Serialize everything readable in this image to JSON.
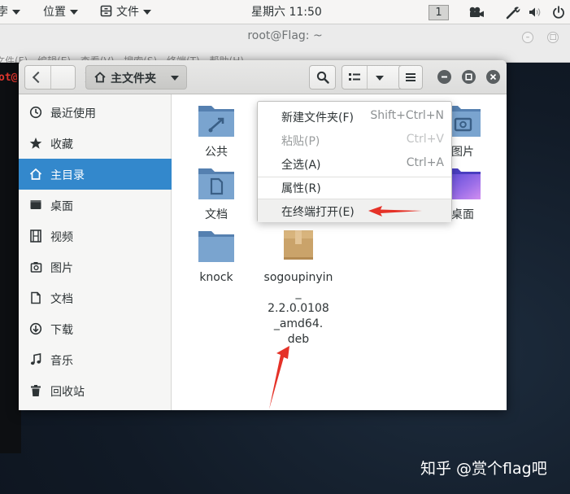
{
  "topbar": {
    "partial_left": "孛",
    "places_label": "位置",
    "files_label": "文件",
    "clock": "星期六 11:50",
    "workspace": "1"
  },
  "terminal": {
    "title": "root@Flag: ~",
    "menu": "文件(F)  编辑(E)  查看(V)  搜索(S)  终端(T)  帮助(H)",
    "prompt": "ot@"
  },
  "file_manager": {
    "path_label": "主文件夹",
    "sidebar": [
      {
        "label": "最近使用",
        "icon": "clock-icon"
      },
      {
        "label": "收藏",
        "icon": "star-icon"
      },
      {
        "label": "主目录",
        "icon": "home-icon",
        "active": true
      },
      {
        "label": "桌面",
        "icon": "desktop-icon"
      },
      {
        "label": "视频",
        "icon": "film-icon"
      },
      {
        "label": "图片",
        "icon": "picture-icon"
      },
      {
        "label": "文档",
        "icon": "document-icon"
      },
      {
        "label": "下载",
        "icon": "download-icon"
      },
      {
        "label": "音乐",
        "icon": "music-icon"
      },
      {
        "label": "回收站",
        "icon": "trash-icon"
      }
    ],
    "files": [
      {
        "label": "公共",
        "icon": "folder-share-icon"
      },
      {
        "label": "图片",
        "icon": "folder-pictures-icon"
      },
      {
        "label": "文档",
        "icon": "folder-documents-icon"
      },
      {
        "label": "桌面",
        "icon": "folder-desktop-icon"
      },
      {
        "label": "knock",
        "icon": "folder-icon"
      },
      {
        "label": "sogoupinyin\n_\n2.2.0.0108\n_amd64.\ndeb",
        "icon": "package-icon"
      }
    ]
  },
  "context_menu": [
    {
      "label": "新建文件夹(F)",
      "accel": "Shift+Ctrl+N",
      "disabled": false
    },
    {
      "label": "粘贴(P)",
      "accel": "Ctrl+V",
      "disabled": true
    },
    {
      "label": "全选(A)",
      "accel": "Ctrl+A",
      "disabled": false
    },
    {
      "label": "属性(R)",
      "accel": "",
      "disabled": false
    },
    {
      "label": "在终端打开(E)",
      "accel": "",
      "disabled": false
    }
  ],
  "watermark": "知乎 @赏个flag吧",
  "colors": {
    "accent": "#3388cc",
    "arrow": "#e53228",
    "folder": "#6f9ccc"
  }
}
